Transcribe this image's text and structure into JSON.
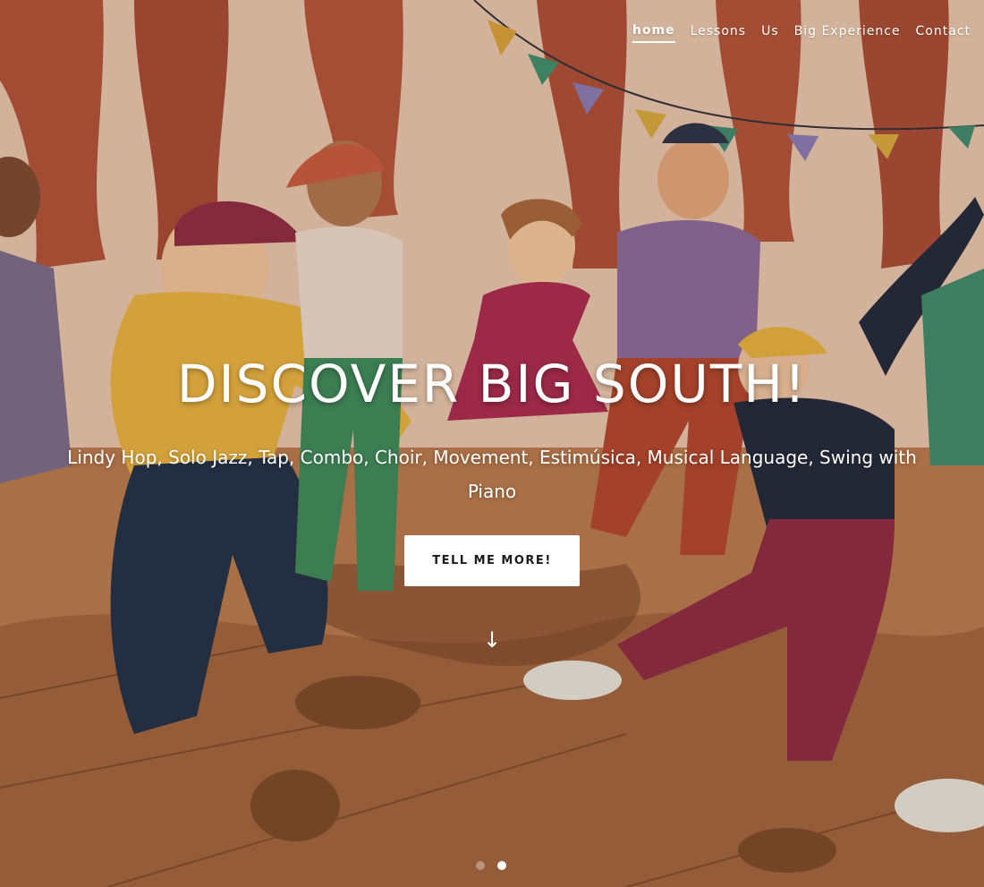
{
  "nav": {
    "items": [
      {
        "label": "home",
        "active": true
      },
      {
        "label": "Lessons",
        "active": false
      },
      {
        "label": "Us",
        "active": false
      },
      {
        "label": "Big Experience",
        "active": false
      },
      {
        "label": "Contact",
        "active": false
      }
    ]
  },
  "hero": {
    "headline": "DISCOVER BIG SOUTH!",
    "subtitle": "Lindy Hop, Solo Jazz, Tap, Combo, Choir, Movement, Estimúsica, Musical Language, Swing with Piano",
    "cta_label": "TELL ME MORE!",
    "scroll_icon": "arrow-down-icon",
    "scroll_glyph": "↓"
  },
  "slider": {
    "count": 2,
    "active_index": 1
  },
  "colors": {
    "accent": "#ffffff",
    "background_floor": "#b3764e",
    "curtain": "#b5533a",
    "wall": "#e8cfba"
  }
}
